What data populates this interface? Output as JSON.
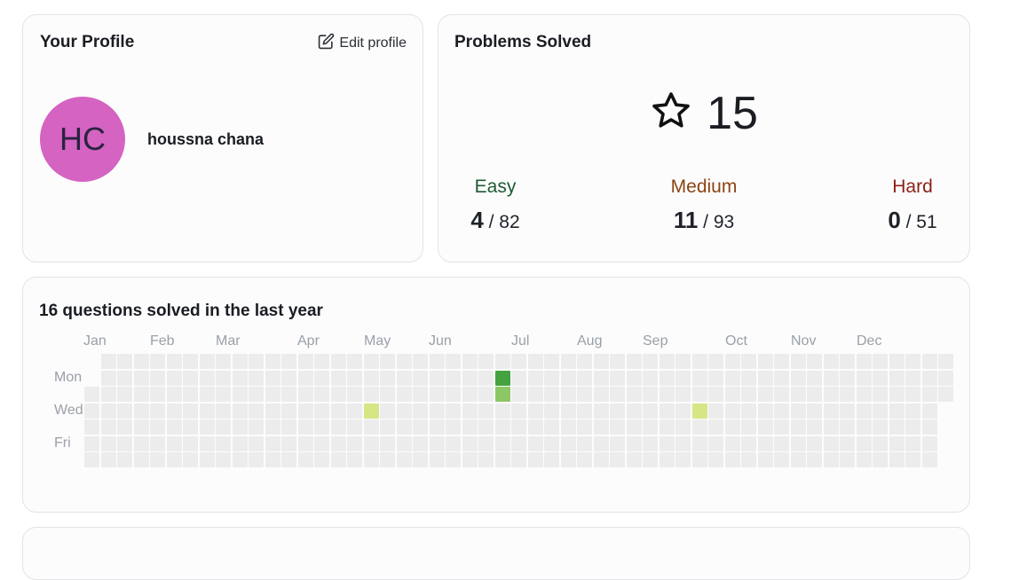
{
  "profile": {
    "title": "Your Profile",
    "edit_label": "Edit profile",
    "initials": "HC",
    "name": "houssna chana",
    "avatar_color": "#d463c2"
  },
  "solved": {
    "title": "Problems Solved",
    "total": "15",
    "total_icon": "star-icon",
    "easy": {
      "label": "Easy",
      "solved": "4",
      "total": "/ 82",
      "color": "#1e5a33"
    },
    "medium": {
      "label": "Medium",
      "solved": "11",
      "total": "/ 93",
      "color": "#8a4414"
    },
    "hard": {
      "label": "Hard",
      "solved": "0",
      "total": "/ 51",
      "color": "#8c1f16"
    }
  },
  "heatmap": {
    "title": "16 questions solved in the last year",
    "months": [
      "Jan",
      "Feb",
      "Mar",
      "Apr",
      "May",
      "Jun",
      "Jul",
      "Aug",
      "Sep",
      "Oct",
      "Nov",
      "Dec"
    ],
    "days": [
      "Mon",
      "Wed",
      "Fri"
    ],
    "colors": {
      "empty": "#ececec",
      "low": "#d6e685",
      "mid": "#8cc665",
      "high": "#44a340"
    },
    "active_cells": [
      {
        "week": 25,
        "day": 1,
        "level": "high"
      },
      {
        "week": 25,
        "day": 2,
        "level": "mid"
      },
      {
        "week": 17,
        "day": 3,
        "level": "low"
      },
      {
        "week": 37,
        "day": 3,
        "level": "low"
      }
    ]
  }
}
